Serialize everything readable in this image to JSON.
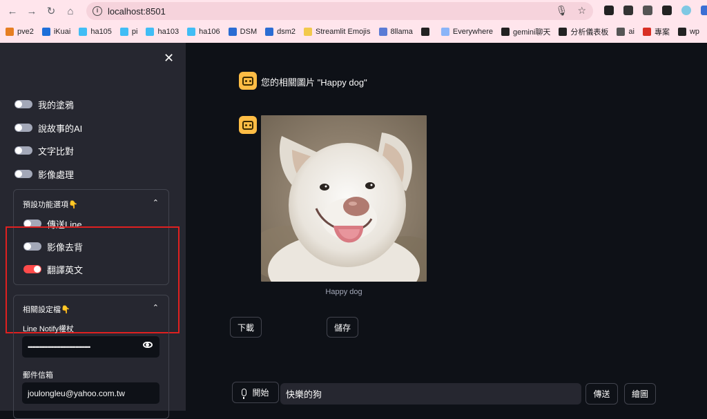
{
  "browser": {
    "url": "localhost:8501",
    "bookmarks": [
      {
        "label": "pve2",
        "color": "#e67e22"
      },
      {
        "label": "iKuai",
        "color": "#1e6fd9"
      },
      {
        "label": "ha105",
        "color": "#41bdf5"
      },
      {
        "label": "pi",
        "color": "#41bdf5"
      },
      {
        "label": "ha103",
        "color": "#41bdf5"
      },
      {
        "label": "ha106",
        "color": "#41bdf5"
      },
      {
        "label": "DSM",
        "color": "#2b6cd3"
      },
      {
        "label": "dsm2",
        "color": "#2b6cd3"
      },
      {
        "label": "Streamlit Emojis",
        "color": "#f2c94c"
      },
      {
        "label": "8llama",
        "color": "#5b7bd5"
      },
      {
        "label": "",
        "color": "#222222"
      },
      {
        "label": "Everywhere",
        "color": "#8ab4f8"
      },
      {
        "label": "gemini聊天",
        "color": "#222222"
      },
      {
        "label": "分析儀表板",
        "color": "#222222"
      },
      {
        "label": "ai",
        "color": "#555555"
      },
      {
        "label": "專案",
        "color": "#d93025"
      },
      {
        "label": "wp",
        "color": "#222222"
      }
    ]
  },
  "sidebar": {
    "toggles": [
      {
        "label": "我的塗鴉",
        "on": false
      },
      {
        "label": "說故事的AI",
        "on": false
      },
      {
        "label": "文字比對",
        "on": false
      },
      {
        "label": "影像處理",
        "on": false
      }
    ],
    "preset": {
      "title": "預設功能選項👇",
      "toggles": [
        {
          "label": "傳送Line",
          "on": false
        },
        {
          "label": "影像去背",
          "on": false
        },
        {
          "label": "翻譯英文",
          "on": true
        }
      ]
    },
    "settings": {
      "title": "相關設定檔👇",
      "line_label": "Line Notify權杖",
      "line_value": "••••••••••••••••••••••••••••••••••••••••••",
      "email_label": "郵件信箱",
      "email_value": "joulongleu@yahoo.com.tw"
    }
  },
  "main": {
    "message": "您的相關圖片 \"Happy dog\"",
    "caption": "Happy dog",
    "download_label": "下載",
    "save_label": "儲存",
    "start_label": "開始",
    "input_value": "快樂的狗",
    "send_label": "傳送",
    "draw_label": "繪圖"
  },
  "colors": {
    "accent": "#ff4b4b",
    "avatar": "#ffbd45",
    "highlight": "#e02020"
  }
}
